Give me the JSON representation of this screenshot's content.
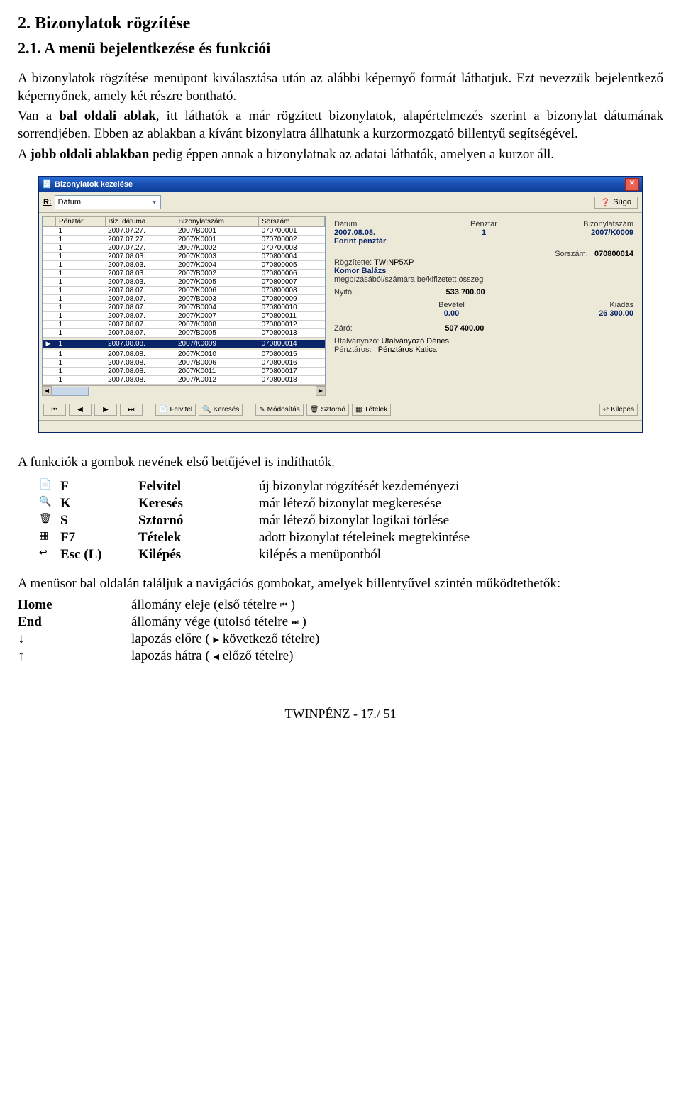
{
  "doc": {
    "h2": "2. Bizonylatok rögzítése",
    "h3": "2.1. A menü bejelentkezése és funkciói",
    "p1a": "A bizonylatok rögzítése menüpont kiválasztása után az alábbi képernyő formát láthatjuk. Ezt nevezzük bejelentkező képernyőnek, amely két részre bontható.",
    "p1b_before": "Van a ",
    "p1b_bold": "bal oldali ablak",
    "p1b_after": ", itt láthatók a már rögzített bizonylatok, alapértelmezés szerint a bizonylat dátumának sorrendjében. Ebben az ablakban a kívánt bizonylatra állhatunk a kurzormozgató billentyű segítségével.",
    "p1c_before": "A ",
    "p1c_bold": "jobb oldali ablakban",
    "p1c_after": " pedig éppen annak a bizonylatnak az adatai láthatók, amelyen a kurzor áll.",
    "p2": "A funkciók a gombok nevének első betűjével is indíthatók.",
    "p3": "A menüsor bal oldalán találjuk a navigációs gombokat, amelyek billentyűvel szintén működtethetők:",
    "footer": "TWINPÉNZ - 17./ 51"
  },
  "win": {
    "title": "Bizonylatok kezelése",
    "R_label": "R:",
    "combo_value": "Dátum",
    "help": "Súgó",
    "grid_headers": [
      "",
      "Pénztár",
      "Biz. dátuma",
      "Bizonylatszám",
      "Sorszám"
    ],
    "grid_rows": [
      [
        "",
        "1",
        "2007.07.27.",
        "2007/B0001",
        "070700001"
      ],
      [
        "",
        "1",
        "2007.07.27.",
        "2007/K0001",
        "070700002"
      ],
      [
        "",
        "1",
        "2007.07.27.",
        "2007/K0002",
        "070700003"
      ],
      [
        "",
        "1",
        "2007.08.03.",
        "2007/K0003",
        "070800004"
      ],
      [
        "",
        "1",
        "2007.08.03.",
        "2007/K0004",
        "070800005"
      ],
      [
        "",
        "1",
        "2007.08.03.",
        "2007/B0002",
        "070800006"
      ],
      [
        "",
        "1",
        "2007.08.03.",
        "2007/K0005",
        "070800007"
      ],
      [
        "",
        "1",
        "2007.08.07.",
        "2007/K0006",
        "070800008"
      ],
      [
        "",
        "1",
        "2007.08.07.",
        "2007/B0003",
        "070800009"
      ],
      [
        "",
        "1",
        "2007.08.07.",
        "2007/B0004",
        "070800010"
      ],
      [
        "",
        "1",
        "2007.08.07.",
        "2007/K0007",
        "070800011"
      ],
      [
        "",
        "1",
        "2007.08.07.",
        "2007/K0008",
        "070800012"
      ],
      [
        "",
        "1",
        "2007.08.07.",
        "2007/B0005",
        "070800013"
      ],
      [
        "▶",
        "1",
        "2007.08.08.",
        "2007/K0009",
        "070800014"
      ],
      [
        "",
        "1",
        "2007.08.08.",
        "2007/K0010",
        "070800015"
      ],
      [
        "",
        "1",
        "2007.08.08.",
        "2007/B0006",
        "070800016"
      ],
      [
        "",
        "1",
        "2007.08.08.",
        "2007/K0011",
        "070800017"
      ],
      [
        "",
        "1",
        "2007.08.08.",
        "2007/K0012",
        "070800018"
      ]
    ],
    "selected_index": 13,
    "detail": {
      "lbl_datum": "Dátum",
      "val_datum": "2007.08.08.",
      "lbl_penztar": "Pénztár",
      "val_penztar": "1",
      "lbl_bizszam": "Bizonylatszám",
      "val_bizszam": "2007/K0009",
      "penztar_nev": "Forint pénztár",
      "lbl_sorszam": "Sorszám:",
      "val_sorszam": "070800014",
      "lbl_rogz": "Rögzítette:",
      "val_rogz": "TWINP5XP",
      "partner": "Komor Balázs",
      "partner_desc": "megbízásából/számára be/kifizetett összeg",
      "lbl_nyito": "Nyitó:",
      "val_nyito": "533 700.00",
      "lbl_bevetel": "Bevétel",
      "val_bevetel": "0.00",
      "lbl_kiadas": "Kiadás",
      "val_kiadas": "26 300.00",
      "lbl_zaro": "Záró:",
      "val_zaro": "507 400.00",
      "lbl_utalv": "Utalványozó:",
      "val_utalv": "Utalványozó Dénes",
      "lbl_penztaros": "Pénztáros:",
      "val_penztaros": "Pénztáros Katica"
    },
    "buttons": {
      "felvitel": "Felvitel",
      "kereses": "Keresés",
      "modositas": "Módosítás",
      "sztorno": "Sztornó",
      "tetelek": "Tételek",
      "kilepes": "Kilépés"
    }
  },
  "shortcuts": [
    {
      "icon": "📄",
      "key": "F",
      "name": "Felvitel",
      "desc": "új bizonylat rögzítését kezdeményezi"
    },
    {
      "icon": "🔍",
      "key": "K",
      "name": "Keresés",
      "desc": "már létező bizonylat megkeresése"
    },
    {
      "icon": "🗑",
      "key": "S",
      "name": "Sztornó",
      "desc": "már létező bizonylat logikai törlése"
    },
    {
      "icon": "▦",
      "key": "F7",
      "name": "Tételek",
      "desc": "adott bizonylat tételeinek megtekintése"
    },
    {
      "icon": "↩",
      "key": "Esc (L)",
      "name": "Kilépés",
      "desc": "kilépés a menüpontból"
    }
  ],
  "nav": [
    {
      "key": "Home",
      "desc_before": "állomány eleje (első tételre ",
      "glyph": "⏮",
      "desc_after": " )"
    },
    {
      "key": "End",
      "desc_before": "állomány vége (utolsó tételre ",
      "glyph": "⏭",
      "desc_after": " )"
    },
    {
      "key": "↓",
      "desc_before": "lapozás előre ( ",
      "glyph": "▶",
      "desc_after": " következő tételre)"
    },
    {
      "key": "↑",
      "desc_before": "lapozás hátra ( ",
      "glyph": "◀",
      "desc_after": " előző tételre)"
    }
  ]
}
